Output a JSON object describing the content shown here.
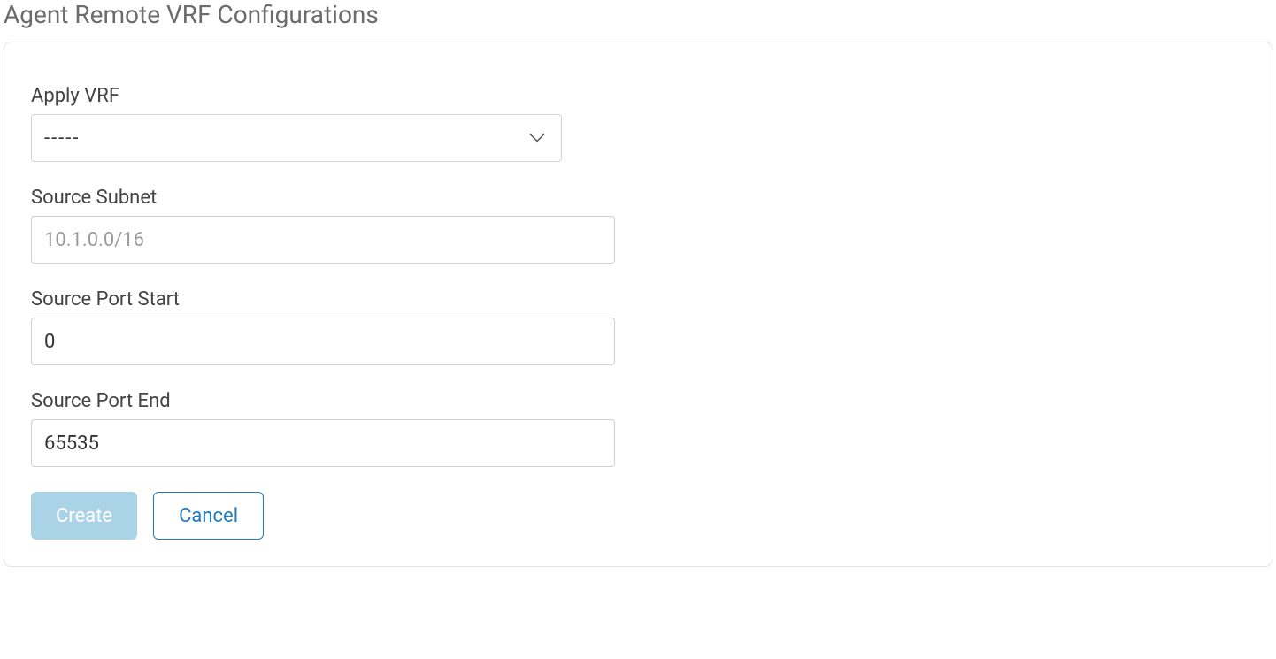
{
  "page": {
    "title": "Agent Remote VRF Configurations"
  },
  "form": {
    "apply_vrf": {
      "label": "Apply VRF",
      "selected_display": "-----"
    },
    "source_subnet": {
      "label": "Source Subnet",
      "placeholder": "10.1.0.0/16",
      "value": ""
    },
    "source_port_start": {
      "label": "Source Port Start",
      "value": "0"
    },
    "source_port_end": {
      "label": "Source Port End",
      "value": "65535"
    }
  },
  "buttons": {
    "create": "Create",
    "cancel": "Cancel"
  }
}
